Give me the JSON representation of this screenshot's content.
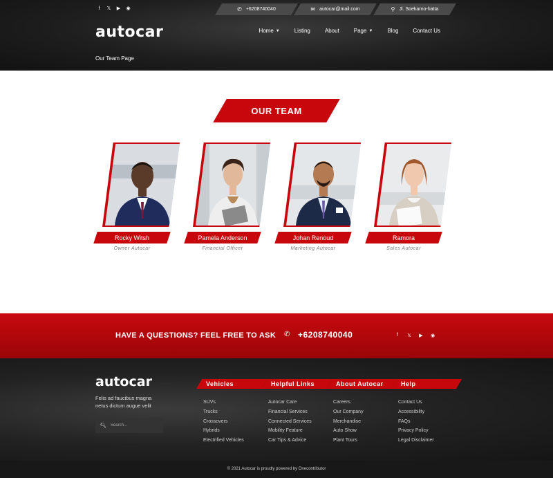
{
  "header": {
    "social_icons": [
      "facebook-icon",
      "twitter-icon",
      "youtube-icon",
      "instagram-icon"
    ],
    "phone": "+6208740040",
    "email": "autocar@mail.com",
    "address": "Jl. Soekarno-hatta",
    "logo": "autocar",
    "nav": {
      "home": "Home",
      "listing": "Listing",
      "about": "About",
      "page": "Page",
      "blog": "Blog",
      "contact": "Contact Us"
    },
    "breadcrumb": "Our Team Page"
  },
  "team": {
    "title": "OUR TEAM",
    "members": [
      {
        "name": "Rocky Witsh",
        "role": "Owner Autocar"
      },
      {
        "name": "Pamela Anderson",
        "role": "Financial Officer"
      },
      {
        "name": "Johan Renoud",
        "role": "Marketing Autocar"
      },
      {
        "name": "Ramora",
        "role": "Sales Autocar"
      }
    ]
  },
  "cta": {
    "text": "HAVE A QUESTIONS? FEEL FREE TO ASK",
    "phone": "+6208740040"
  },
  "footer": {
    "logo": "autocar",
    "description": "Felis ad faucibus magna netus dictum augue velit",
    "search_placeholder": "Search...",
    "columns": [
      {
        "title": "Vehicles",
        "links": [
          "SUVs",
          "Trucks",
          "Crossovers",
          "Hybrids",
          "Electrified Vehicles"
        ]
      },
      {
        "title": "Helpful Links",
        "links": [
          "Autocar Care",
          "Financial Services",
          "Connected Services",
          "Mobility Feature",
          "Car Tips & Advice"
        ]
      },
      {
        "title": "About Autocar",
        "links": [
          "Careers",
          "Our Company",
          "Merchandise",
          "Auto Show",
          "Plant Tours"
        ]
      },
      {
        "title": "Help",
        "links": [
          "Contact Us",
          "Accessibility",
          "FAQs",
          "Privacy Policy",
          "Legal Disclaimer"
        ]
      }
    ],
    "copyright": "© 2021 Autocar is proudly powered by Onecontributor"
  },
  "colors": {
    "accent": "#c8070c",
    "dark": "#1e1e1e"
  }
}
